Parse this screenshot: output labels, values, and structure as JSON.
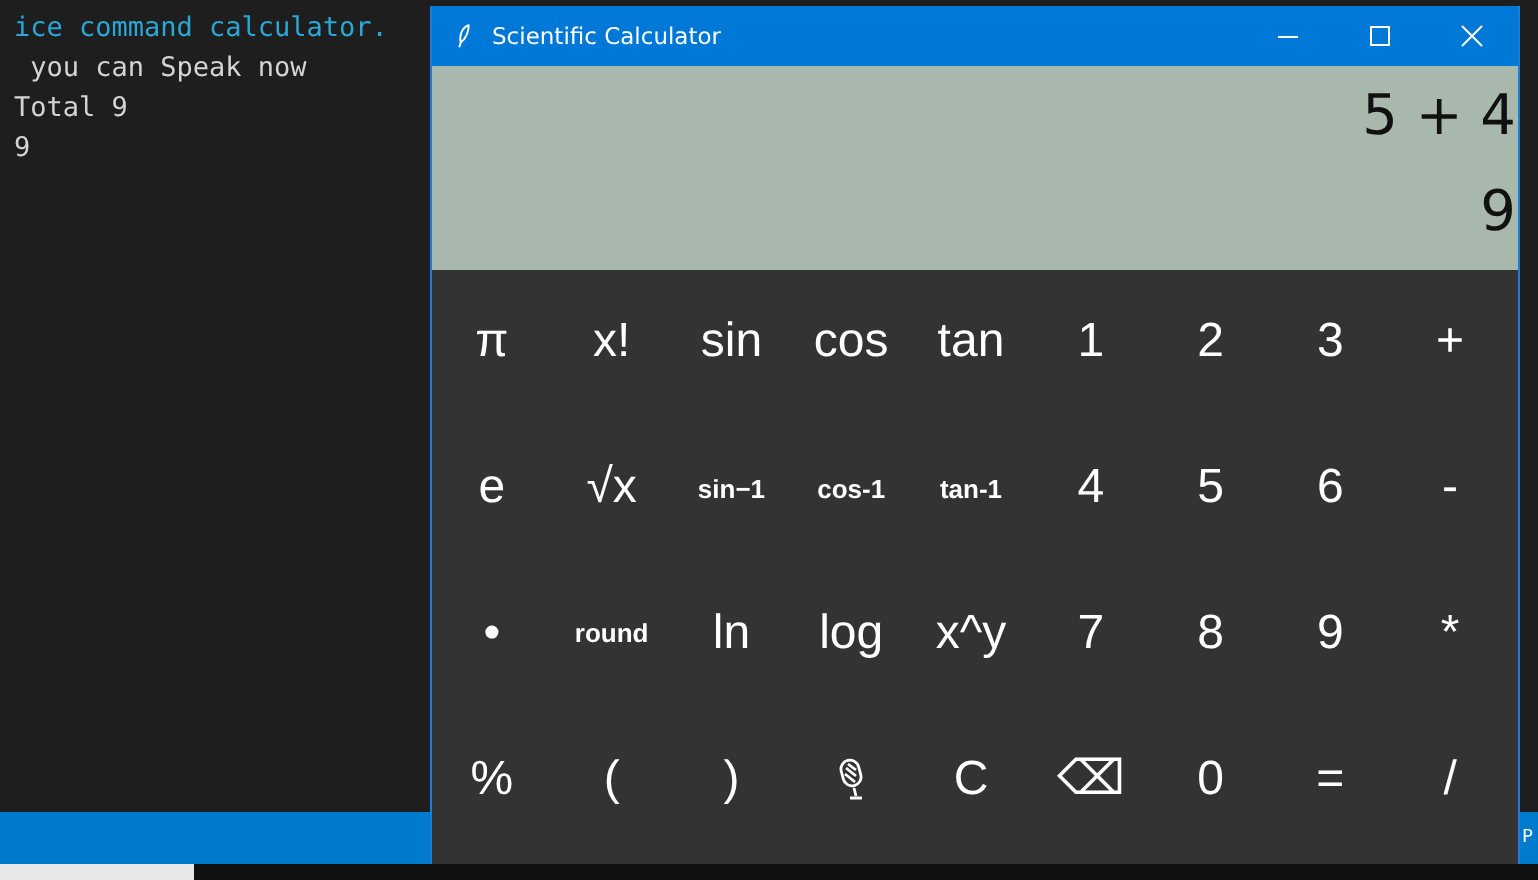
{
  "terminal": {
    "lines": [
      {
        "text": "ice command calculator.",
        "kind": "info"
      },
      {
        "text": " you can Speak now",
        "kind": "plain"
      },
      {
        "text": "Total 9",
        "kind": "plain"
      },
      {
        "text": "9",
        "kind": "plain"
      }
    ]
  },
  "status_bar": {
    "right_text": "P"
  },
  "window": {
    "title": "Scientific Calculator"
  },
  "display": {
    "expression": "5 + 4",
    "result": "9"
  },
  "keys": [
    [
      {
        "label": "π",
        "kind": "big"
      },
      {
        "label": "x!",
        "kind": "big"
      },
      {
        "label": "sin",
        "kind": "big"
      },
      {
        "label": "cos",
        "kind": "big"
      },
      {
        "label": "tan",
        "kind": "big"
      },
      {
        "label": "1",
        "kind": "big"
      },
      {
        "label": "2",
        "kind": "big"
      },
      {
        "label": "3",
        "kind": "big"
      },
      {
        "label": "+",
        "kind": "big"
      }
    ],
    [
      {
        "label": "e",
        "kind": "big"
      },
      {
        "label": "√x",
        "kind": "big"
      },
      {
        "label": "sin−1",
        "kind": "small"
      },
      {
        "label": "cos-1",
        "kind": "small"
      },
      {
        "label": "tan-1",
        "kind": "small"
      },
      {
        "label": "4",
        "kind": "big"
      },
      {
        "label": "5",
        "kind": "big"
      },
      {
        "label": "6",
        "kind": "big"
      },
      {
        "label": "-",
        "kind": "big"
      }
    ],
    [
      {
        "label": "•",
        "kind": "big"
      },
      {
        "label": "round",
        "kind": "small"
      },
      {
        "label": "ln",
        "kind": "big"
      },
      {
        "label": "log",
        "kind": "big"
      },
      {
        "label": "x^y",
        "kind": "big"
      },
      {
        "label": "7",
        "kind": "big"
      },
      {
        "label": "8",
        "kind": "big"
      },
      {
        "label": "9",
        "kind": "big"
      },
      {
        "label": "*",
        "kind": "big"
      }
    ],
    [
      {
        "label": "%",
        "kind": "big"
      },
      {
        "label": "(",
        "kind": "big"
      },
      {
        "label": ")",
        "kind": "big"
      },
      {
        "kind": "mic"
      },
      {
        "label": "C",
        "kind": "big"
      },
      {
        "label": "⌫",
        "kind": "big"
      },
      {
        "label": "0",
        "kind": "big"
      },
      {
        "label": "=",
        "kind": "big"
      },
      {
        "label": "/",
        "kind": "big"
      }
    ]
  ]
}
